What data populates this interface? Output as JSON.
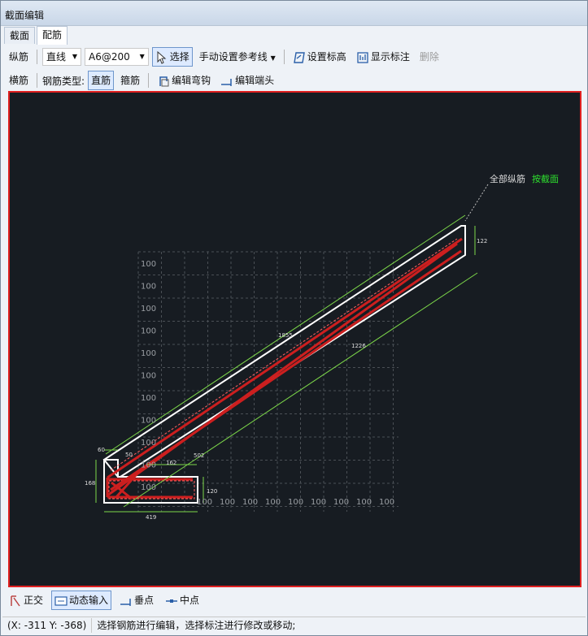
{
  "window": {
    "title": "截面编辑"
  },
  "tabs": [
    {
      "label": "截面"
    },
    {
      "label": "配筋"
    }
  ],
  "toolbar1": {
    "rebar_label": "纵筋",
    "line_type": "直线",
    "spec": "A6@200",
    "select_label": "选择",
    "ref_line_label": "手动设置参考线",
    "set_elevation_label": "设置标高",
    "show_dim_label": "显示标注",
    "delete_label": "删除"
  },
  "toolbar2": {
    "transverse_label": "横筋",
    "rebar_type_label": "钢筋类型:",
    "straight_label": "直筋",
    "stirrup_label": "箍筋",
    "edit_hook_label": "编辑弯钩",
    "edit_end_label": "编辑端头"
  },
  "drawing": {
    "callout_text": "全部纵筋",
    "callout_link": "按截面",
    "grid_labels_y": [
      "100",
      "100",
      "100",
      "100",
      "100",
      "100",
      "100",
      "100",
      "100",
      "100",
      "100"
    ],
    "grid_labels_x": [
      "100",
      "100",
      "100",
      "100",
      "100",
      "100",
      "100",
      "100",
      "100"
    ],
    "dims": {
      "d1855": "1855",
      "d1226": "1226",
      "d122": "122",
      "d60": "60",
      "d50": "50",
      "d162": "162",
      "d502": "502",
      "d168": "168",
      "d120": "120",
      "d419": "419"
    }
  },
  "bottom": {
    "ortho_label": "正交",
    "dynamic_input_label": "动态输入",
    "perp_label": "垂点",
    "mid_label": "中点"
  },
  "status": {
    "coords": "(X: -311 Y: -368)",
    "message": "选择钢筋进行编辑，选择标注进行修改或移动;"
  }
}
